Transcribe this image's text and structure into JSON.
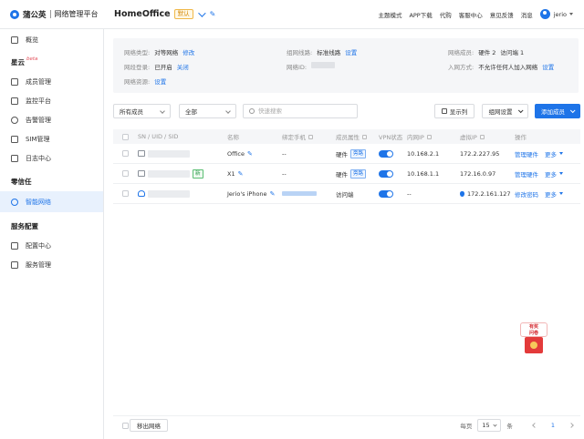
{
  "header": {
    "brand": "蒲公英",
    "brand_sub": "网络管理平台",
    "network_name": "HomeOffice",
    "default_badge": "默认",
    "links": [
      "主题模式",
      "APP下载",
      "代购",
      "客服中心",
      "意见反馈",
      "消息"
    ],
    "user": "jerio"
  },
  "sidebar": {
    "overview": "概览",
    "group_xingyun": "星云",
    "beta": "beta",
    "members": "成员管理",
    "monitor": "监控平台",
    "alerts": "告警管理",
    "sim": "SIM管理",
    "logs": "日志中心",
    "group_zero": "零信任",
    "smart_net": "智能网络",
    "group_service": "服务配置",
    "config_center": "配置中心",
    "service_mgmt": "服务管理"
  },
  "info": {
    "net_type_k": "网络类型:",
    "net_type_v": "对等网络",
    "net_type_link": "修改",
    "group_line_k": "组网线路:",
    "group_line_v": "标准线路",
    "group_line_link": "设置",
    "members_k": "网络成员:",
    "members_v": "硬件 2",
    "members_v2": "访问端 1",
    "sync_k": "网段登录:",
    "sync_v": "已开启",
    "sync_link": "关闭",
    "net_id_k": "网络ID:",
    "join_k": "入网方式:",
    "join_v": "不允许任何人加入网络",
    "join_link": "设置",
    "resource_k": "网络资源:",
    "resource_link": "设置"
  },
  "toolbar": {
    "filter_members": "所有成员",
    "filter_all": "全部",
    "search_placeholder": "快速搜索",
    "show_columns": "显示列",
    "group_settings": "组网设置",
    "add_member": "添加成员"
  },
  "table": {
    "headers": [
      "SN / UID / SID",
      "名称",
      "绑定手机",
      "成员属性",
      "VPN状态",
      "内网IP",
      "虚拟IP",
      "操作"
    ],
    "rows": [
      {
        "name": "Office",
        "phone": "--",
        "attr": "硬件",
        "attr_tag": "旁路",
        "lan_ip": "10.168.2.1",
        "vip": "172.2.227.95",
        "op1": "管理硬件",
        "op2": "更多"
      },
      {
        "tag": "新",
        "name": "X1",
        "phone": "--",
        "attr": "硬件",
        "attr_tag": "旁路",
        "lan_ip": "10.168.1.1",
        "vip": "172.16.0.97",
        "op1": "管理硬件",
        "op2": "更多"
      },
      {
        "name": "Jerio's iPhone",
        "attr": "访问端",
        "lan_ip": "--",
        "vip": "172.2.161.127",
        "op1": "修改密码",
        "op2": "更多"
      }
    ]
  },
  "promo": {
    "line1": "有奖",
    "line2": "问卷"
  },
  "footer": {
    "exit_btn": "移出网络",
    "per_page": "每页",
    "per_page_value": "15",
    "per_page_unit": "条",
    "page": "1"
  }
}
